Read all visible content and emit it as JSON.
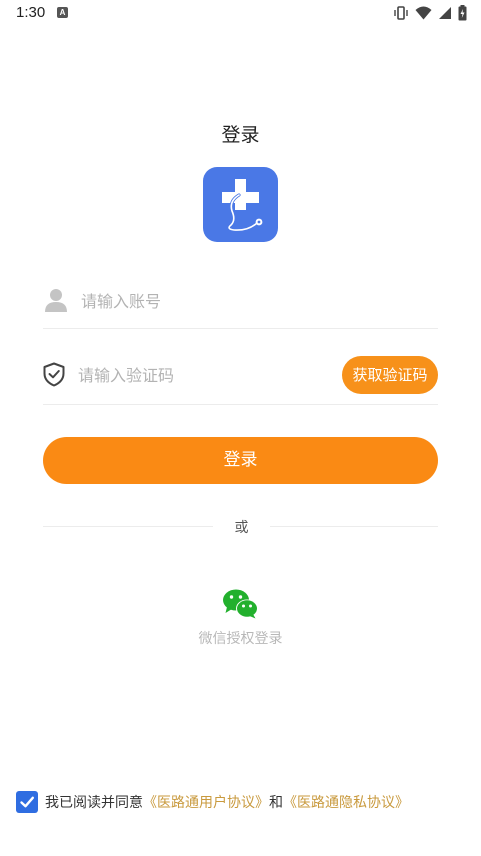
{
  "status_bar": {
    "time": "1:30",
    "notification_icon": "a-notification-icon",
    "icons": [
      "vibrate-icon",
      "wifi-icon",
      "signal-icon",
      "battery-charging-icon"
    ]
  },
  "page": {
    "title": "登录"
  },
  "logo": {
    "icon": "medical-cross-stethoscope-logo",
    "color": "#4a78e6"
  },
  "form": {
    "account_placeholder": "请输入账号",
    "account_icon": "user-icon",
    "code_placeholder": "请输入验证码",
    "code_icon": "shield-check-icon",
    "get_code_label": "获取验证码",
    "login_label": "登录",
    "accent_color": "#fa8a14"
  },
  "divider": {
    "text": "或"
  },
  "wechat": {
    "icon": "wechat-icon",
    "label": "微信授权登录",
    "color": "#22b02d"
  },
  "agreement": {
    "checked": true,
    "prefix": "我已阅读并同意",
    "user_agreement": "《医路通用户协议》",
    "conjunction": "和",
    "privacy_agreement": "《医路通隐私协议》",
    "link_color": "#c99a3e"
  }
}
